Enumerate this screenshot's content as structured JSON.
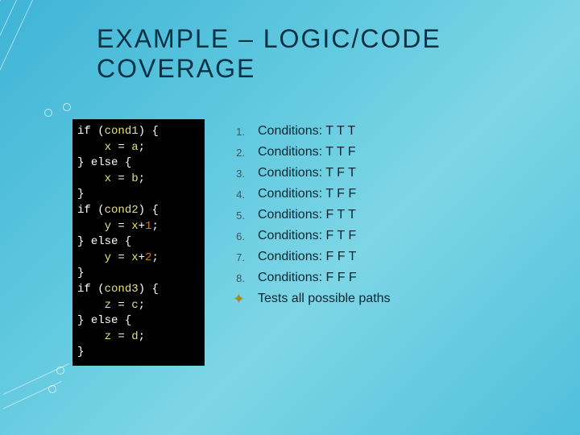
{
  "title_line1": "EXAMPLE – LOGIC/CODE",
  "title_line2": "COVERAGE",
  "code": {
    "l1": "if (cond1) {",
    "l2": "    x = a;",
    "l3": "} else {",
    "l4": "    x = b;",
    "l5": "}",
    "l6": "if (cond2) {",
    "l7": "    y = x+1;",
    "l8": "} else {",
    "l9": "    y = x+2;",
    "l10": "}",
    "l11": "if (cond3) {",
    "l12": "    z = c;",
    "l13": "} else {",
    "l14": "    z = d;",
    "l15": "}"
  },
  "list": [
    {
      "n": "1.",
      "t": "Conditions: T T T"
    },
    {
      "n": "2.",
      "t": "Conditions: T T F"
    },
    {
      "n": "3.",
      "t": "Conditions: T F T"
    },
    {
      "n": "4.",
      "t": "Conditions: T F F"
    },
    {
      "n": "5.",
      "t": "Conditions: F T T"
    },
    {
      "n": "6.",
      "t": "Conditions: F T F"
    },
    {
      "n": "7.",
      "t": "Conditions: F F T"
    },
    {
      "n": "8.",
      "t": "Conditions: F F F"
    }
  ],
  "final": "Tests all possible paths"
}
